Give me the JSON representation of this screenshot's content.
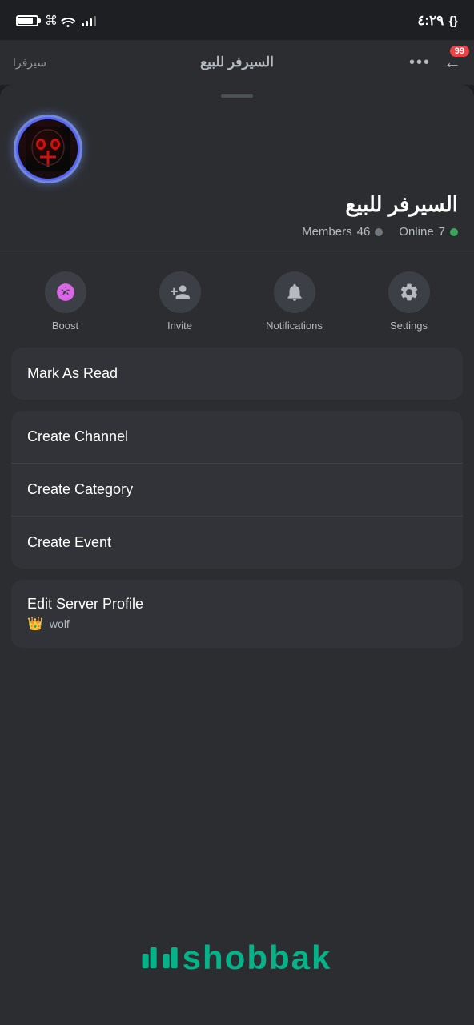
{
  "statusBar": {
    "time": "٤:٢٩",
    "curlyBrace": "{}"
  },
  "topNav": {
    "sideLabel": "سيرفرا",
    "title": "السيرفر للبيع",
    "dotsLabel": "•••",
    "backLabel": "←",
    "badgeCount": "99"
  },
  "dragHandle": {},
  "serverHeader": {
    "name": "السيرفر للبيع",
    "onlineDot": "online",
    "onlineCount": "7",
    "onlineLabel": "Online",
    "membersDot": "members",
    "membersCount": "46",
    "membersLabel": "Members"
  },
  "actionButtons": [
    {
      "id": "boost",
      "label": "Boost",
      "icon": "boost"
    },
    {
      "id": "invite",
      "label": "Invite",
      "icon": "invite"
    },
    {
      "id": "notifications",
      "label": "Notifications",
      "icon": "bell"
    },
    {
      "id": "settings",
      "label": "Settings",
      "icon": "gear"
    }
  ],
  "menuSection1": [
    {
      "id": "mark-as-read",
      "label": "Mark As Read"
    }
  ],
  "menuSection2": [
    {
      "id": "create-channel",
      "label": "Create Channel"
    },
    {
      "id": "create-category",
      "label": "Create Category"
    },
    {
      "id": "create-event",
      "label": "Create Event"
    }
  ],
  "menuSection3": [
    {
      "id": "edit-server-profile",
      "label": "Edit Server Profile"
    }
  ],
  "bottomUser": {
    "crownEmoji": "👑",
    "username": "wolf"
  },
  "watermark": "shobbak"
}
